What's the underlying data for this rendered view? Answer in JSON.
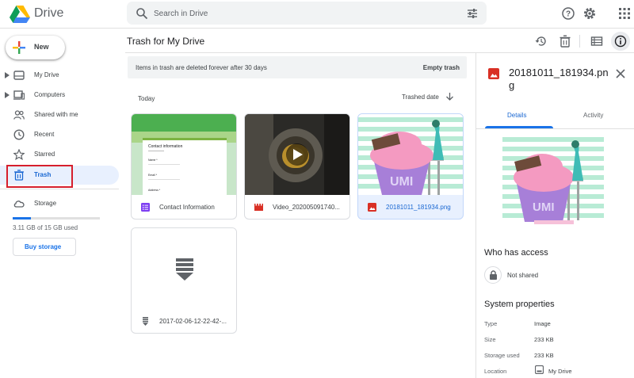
{
  "app": {
    "title": "Drive"
  },
  "search": {
    "placeholder": "Search in Drive"
  },
  "sidebar": {
    "new_label": "New",
    "items": [
      {
        "label": "My Drive"
      },
      {
        "label": "Computers"
      },
      {
        "label": "Shared with me"
      },
      {
        "label": "Recent"
      },
      {
        "label": "Starred"
      },
      {
        "label": "Trash"
      },
      {
        "label": "Storage"
      }
    ],
    "storage": {
      "used_text": "3.11 GB of 15 GB used",
      "used_fraction": 0.207,
      "buy_label": "Buy storage"
    }
  },
  "main": {
    "title": "Trash for My Drive",
    "banner": {
      "message": "Items in trash are deleted forever after 30 days",
      "action": "Empty trash"
    },
    "group_label": "Today",
    "sort_label": "Trashed date",
    "files": [
      {
        "name": "Contact Information",
        "type": "form-icon"
      },
      {
        "name": "Video_202005091740...",
        "type": "video-icon"
      },
      {
        "name": "20181011_181934.png",
        "type": "image-icon",
        "selected": true
      },
      {
        "name": "2017-02-06-12-22-42-...",
        "type": "archive-icon"
      }
    ],
    "form_thumb": {
      "title": "Contact information",
      "f1": "Name *",
      "f2": "Email *",
      "f3": "Address *"
    }
  },
  "details": {
    "filename": "20181011_181934.png",
    "tabs": {
      "details": "Details",
      "activity": "Activity"
    },
    "access": {
      "heading": "Who has access",
      "status": "Not shared"
    },
    "system": {
      "heading": "System properties",
      "rows": [
        {
          "key": "Type",
          "value": "Image"
        },
        {
          "key": "Size",
          "value": "233 KB"
        },
        {
          "key": "Storage used",
          "value": "233 KB"
        },
        {
          "key": "Location",
          "value": "My Drive"
        }
      ]
    }
  },
  "colors": {
    "accent": "#1a73e8",
    "active_bg": "#e8f0fe",
    "highlight": "#d61f2c"
  }
}
